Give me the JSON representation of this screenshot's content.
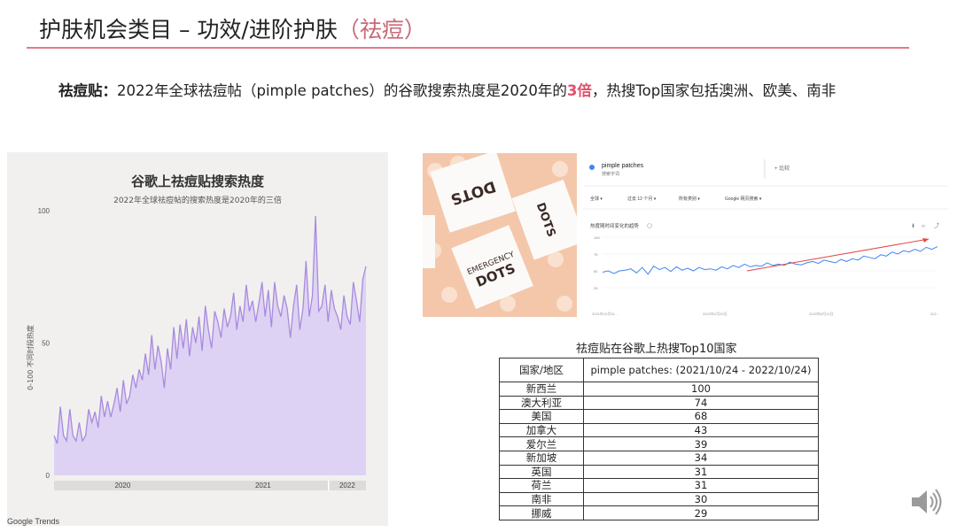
{
  "slide": {
    "title": "护肤机会类目 – 功效/进阶护肤",
    "title_paren": "（祛痘）"
  },
  "headline": {
    "bold_prefix": "祛痘贴：",
    "text_a": "2022年全球祛痘帖（pimple patches）的谷歌搜索热度是2020年的",
    "highlight": "3倍",
    "text_b": "，热搜Top国家包括澳洲、欧美、南非"
  },
  "colors": {
    "accent": "#e07b8b",
    "highlight": "#e0506a",
    "trend_fill": "#ddd2f3",
    "trend_line": "#a98ae0"
  },
  "trend_chart": {
    "title": "谷歌上祛痘贴搜索热度",
    "subtitle": "2022年全球祛痘帖的搜索热度是2020年的三倍",
    "ylabel": "0-100 不同时段热度",
    "footer": "Google Trends"
  },
  "chart_data": {
    "type": "area",
    "title": "谷歌上祛痘贴搜索热度",
    "subtitle": "2022年全球祛痘帖的搜索热度是2020年的三倍",
    "ylabel": "0-100 不同时段热度",
    "ylim": [
      0,
      100
    ],
    "yticks": [
      0,
      50,
      100
    ],
    "xtick_labels": [
      "2020",
      "2021",
      "2022"
    ],
    "values": [
      15,
      12,
      26,
      15,
      13,
      25,
      15,
      13,
      20,
      13,
      15,
      25,
      20,
      24,
      18,
      30,
      22,
      28,
      22,
      27,
      33,
      24,
      36,
      27,
      30,
      38,
      33,
      40,
      36,
      46,
      38,
      53,
      40,
      49,
      43,
      33,
      48,
      40,
      56,
      44,
      57,
      48,
      59,
      45,
      56,
      50,
      60,
      47,
      64,
      55,
      48,
      62,
      58,
      52,
      63,
      56,
      60,
      69,
      55,
      64,
      58,
      72,
      62,
      66,
      58,
      65,
      73,
      60,
      70,
      56,
      73,
      64,
      60,
      68,
      63,
      52,
      64,
      72,
      55,
      63,
      81,
      60,
      68,
      98,
      62,
      64,
      72,
      58,
      70,
      63,
      60,
      55,
      68,
      60,
      57,
      73,
      66,
      58,
      74,
      79
    ]
  },
  "trends_screenshot": {
    "search_term": "pimple patches",
    "term_type": "搜索字词",
    "compare": "+ 比较",
    "filters": [
      "全球 ▾",
      "过去 12 个月 ▾",
      "所有类别 ▾",
      "Google 网页搜索 ▾"
    ],
    "section_title": "热度随时间变化的趋势",
    "y_ticks": [
      "100",
      "75",
      "50",
      "25"
    ],
    "x_ticks": [
      "2021年10月31…",
      "2022年2月20日",
      "2022年6月12日",
      "202…"
    ],
    "values": [
      48,
      50,
      46,
      50,
      51,
      53,
      47,
      55,
      45,
      57,
      52,
      55,
      49,
      56,
      51,
      54,
      50,
      55,
      52,
      53,
      51,
      56,
      53,
      58,
      55,
      60,
      56,
      58,
      57,
      62,
      58,
      60,
      58,
      63,
      60,
      59,
      62,
      64,
      61,
      66,
      64,
      62,
      67,
      64,
      68,
      66,
      72,
      70,
      68,
      74,
      72,
      78,
      75,
      80,
      78,
      82,
      79,
      85,
      82,
      86
    ]
  },
  "top10": {
    "title": "祛痘贴在谷歌上热搜Top10国家",
    "headers": [
      "国家/地区",
      "pimple patches: (2021/10/24 - 2022/10/24)"
    ],
    "rows": [
      [
        "新西兰",
        "100"
      ],
      [
        "澳大利亚",
        "74"
      ],
      [
        "美国",
        "68"
      ],
      [
        "加拿大",
        "43"
      ],
      [
        "爱尔兰",
        "39"
      ],
      [
        "新加坡",
        "34"
      ],
      [
        "英国",
        "31"
      ],
      [
        "荷兰",
        "31"
      ],
      [
        "南非",
        "30"
      ],
      [
        "挪威",
        "29"
      ]
    ]
  },
  "product_photo": {
    "brand_text": "EMERGENCY DOTS"
  }
}
